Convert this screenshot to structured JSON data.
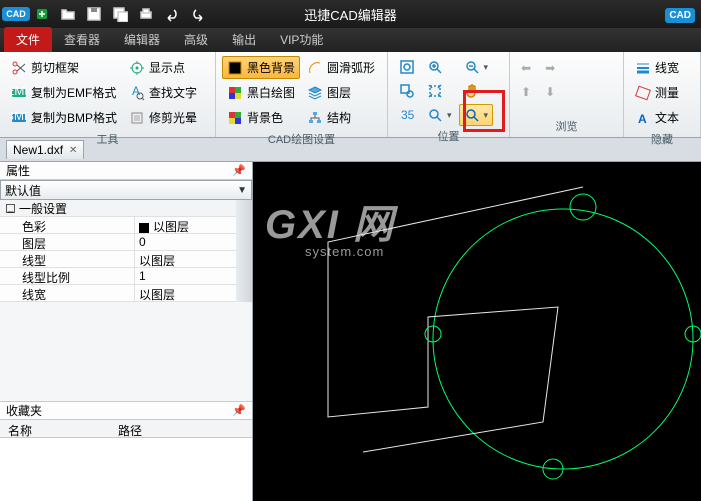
{
  "title": "迅捷CAD编辑器",
  "badge": "CAD",
  "tabs": {
    "file": "文件",
    "viewer": "查看器",
    "editor": "编辑器",
    "advanced": "高级",
    "output": "输出",
    "vip": "VIP功能"
  },
  "group_titles": {
    "tools": "工具",
    "cad_settings": "CAD绘图设置",
    "position": "位置",
    "browse": "浏览",
    "hide": "隐藏"
  },
  "tools": {
    "clip": "剪切框架",
    "emf": "复制为EMF格式",
    "bmp": "复制为BMP格式",
    "showpt": "显示点",
    "findtext": "查找文字",
    "trimhalo": "修剪光晕"
  },
  "cad": {
    "blackbg": "黑色背景",
    "bw": "黑白绘图",
    "bgcolor": "背景色",
    "smootharc": "圆滑弧形",
    "layer": "图层",
    "struct": "结构"
  },
  "browse": {
    "linewidth": "线宽",
    "measure": "测量",
    "text": "文本"
  },
  "doc_tab": "New1.dxf",
  "props": {
    "panel": "属性",
    "default": "默认值",
    "general": "一般设置",
    "rows": [
      {
        "k": "色彩",
        "v": "以图层",
        "swatch": true
      },
      {
        "k": "图层",
        "v": "0"
      },
      {
        "k": "线型",
        "v": "以图层"
      },
      {
        "k": "线型比例",
        "v": "1"
      },
      {
        "k": "线宽",
        "v": "以图层"
      }
    ]
  },
  "fav": {
    "panel": "收藏夹",
    "name": "名称",
    "path": "路径"
  }
}
